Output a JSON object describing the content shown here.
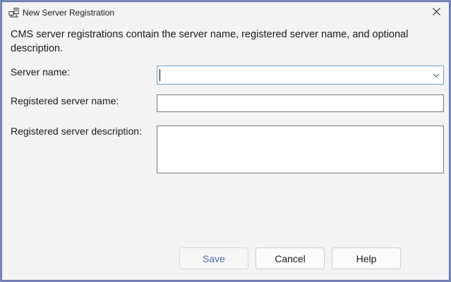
{
  "window": {
    "title": "New Server Registration"
  },
  "description": "CMS server registrations contain the server name, registered server name, and optional description.",
  "form": {
    "server_name_label": "Server name:",
    "server_name_value": "",
    "registered_name_label": "Registered server name:",
    "registered_name_value": "",
    "registered_description_label": "Registered server description:",
    "registered_description_value": ""
  },
  "buttons": {
    "save": "Save",
    "cancel": "Cancel",
    "help": "Help"
  },
  "icons": {
    "title": "server-network-icon",
    "close": "close-icon",
    "dropdown": "chevron-down-icon"
  }
}
